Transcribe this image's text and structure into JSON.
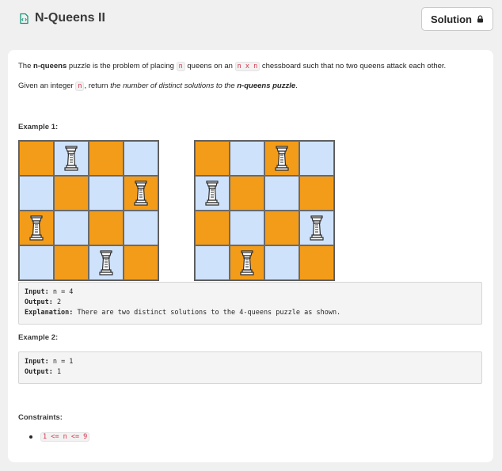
{
  "header": {
    "title": "N-Queens II",
    "solution_label": "Solution",
    "title_icon": "code-file-icon",
    "lock_icon": "lock-icon"
  },
  "description": {
    "p1": {
      "t1": "The ",
      "b1": "n-queens",
      "t2": " puzzle is the problem of placing ",
      "c1": "n",
      "t3": " queens on an ",
      "c2": "n x n",
      "t4": " chessboard such that no two queens attack each other."
    },
    "p2": {
      "t1": "Given an integer ",
      "c1": "n",
      "t2": ", return ",
      "i1": "the number of distinct solutions to the ",
      "bi1": "n-queens puzzle",
      "t3": "."
    }
  },
  "example1": {
    "heading": "Example 1:",
    "boards": [
      {
        "colors": [
          [
            "o",
            "b",
            "o",
            "b"
          ],
          [
            "b",
            "o",
            "b",
            "o"
          ],
          [
            "o",
            "b",
            "o",
            "b"
          ],
          [
            "b",
            "o",
            "b",
            "o"
          ]
        ],
        "queens": [
          [
            0,
            1
          ],
          [
            1,
            3
          ],
          [
            2,
            0
          ],
          [
            3,
            2
          ]
        ]
      },
      {
        "colors": [
          [
            "o",
            "b",
            "o",
            "b"
          ],
          [
            "b",
            "o",
            "b",
            "o"
          ],
          [
            "o",
            "b",
            "o",
            "b"
          ],
          [
            "b",
            "o",
            "b",
            "o"
          ]
        ],
        "queens": [
          [
            0,
            2
          ],
          [
            1,
            0
          ],
          [
            2,
            3
          ],
          [
            3,
            1
          ]
        ]
      }
    ],
    "input_label": "Input:",
    "input_value": " n = 4",
    "output_label": "Output:",
    "output_value": " 2",
    "explanation_label": "Explanation:",
    "explanation_value": " There are two distinct solutions to the 4-queens puzzle as shown."
  },
  "example2": {
    "heading": "Example 2:",
    "input_label": "Input:",
    "input_value": " n = 1",
    "output_label": "Output:",
    "output_value": " 1"
  },
  "constraints": {
    "heading": "Constraints:",
    "items": [
      "1 <= n <= 9"
    ]
  },
  "colors": {
    "orange_square": "#f39c1a",
    "blue_square": "#cfe2fb",
    "code_text": "#d6334a"
  }
}
